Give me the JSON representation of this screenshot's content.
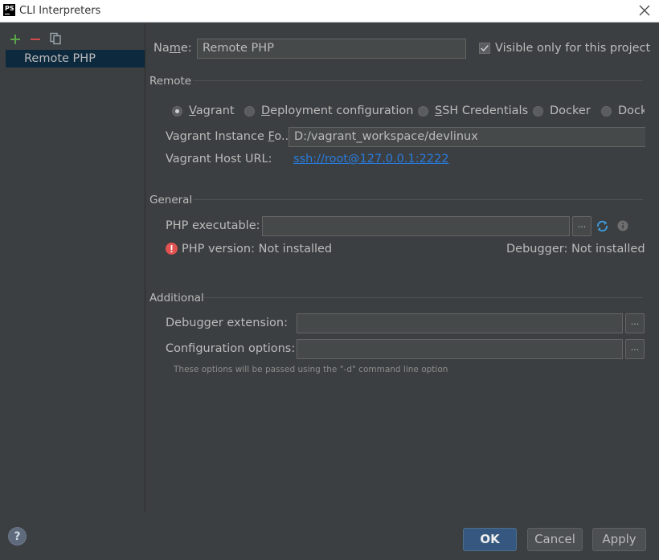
{
  "window": {
    "title": "CLI Interpreters",
    "app_icon_text": "PS"
  },
  "sidebar": {
    "items": [
      {
        "label": "Remote PHP",
        "selected": true
      }
    ]
  },
  "form": {
    "name_label": "Name:",
    "name_value": "Remote PHP",
    "visible_label": "Visible only for this project",
    "visible_checked": true
  },
  "remote": {
    "section_title": "Remote",
    "options": [
      {
        "label": "Vagrant",
        "selected": true
      },
      {
        "label": "Deployment configuration",
        "selected": false
      },
      {
        "label": "SSH Credentials",
        "selected": false
      },
      {
        "label": "Docker",
        "selected": false
      },
      {
        "label": "Dock",
        "selected": false
      }
    ],
    "instance_label": "Vagrant Instance Fo...",
    "instance_value": "D:/vagrant_workspace/devlinux",
    "host_label": "Vagrant Host URL:",
    "host_url": "ssh://root@127.0.0.1:2222"
  },
  "general": {
    "section_title": "General",
    "php_exec_label": "PHP executable:",
    "php_exec_value": "",
    "php_version": "PHP version: Not installed",
    "debugger": "Debugger: Not installed"
  },
  "additional": {
    "section_title": "Additional",
    "debugger_ext_label": "Debugger extension:",
    "config_options_label": "Configuration options:",
    "hint": "These options will be passed using the \"-d\" command line option"
  },
  "buttons": {
    "ok": "OK",
    "cancel": "Cancel",
    "apply": "Apply",
    "browse": "...",
    "help": "?"
  },
  "colors": {
    "background": "#3c3f41",
    "selection": "#0d293e",
    "link": "#287bde",
    "primary": "#365880",
    "error": "#e05252"
  }
}
